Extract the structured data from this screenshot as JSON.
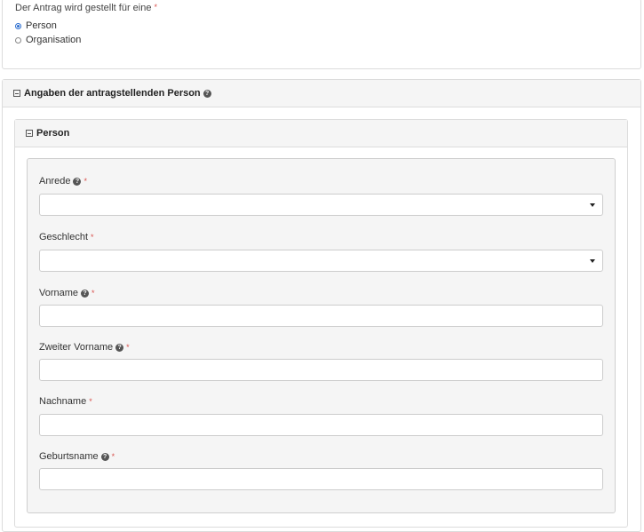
{
  "top": {
    "question": "Der Antrag wird gestellt für eine",
    "required_mark": "*",
    "options": [
      {
        "label": "Person",
        "selected": true
      },
      {
        "label": "Organisation",
        "selected": false
      }
    ]
  },
  "outer_section": {
    "title": "Angaben der antragstellenden Person",
    "help": "?"
  },
  "inner_section": {
    "title": "Person"
  },
  "fields": [
    {
      "label": "Anrede",
      "has_help": true,
      "required": "*",
      "type": "select",
      "value": ""
    },
    {
      "label": "Geschlecht",
      "has_help": false,
      "required": "*",
      "type": "select",
      "value": ""
    },
    {
      "label": "Vorname",
      "has_help": true,
      "required": "*",
      "type": "text",
      "value": ""
    },
    {
      "label": "Zweiter Vorname",
      "has_help": true,
      "required": "*",
      "type": "text",
      "value": ""
    },
    {
      "label": "Nachname",
      "has_help": false,
      "required": "*",
      "type": "text",
      "value": ""
    },
    {
      "label": "Geburtsname",
      "has_help": true,
      "required": "*",
      "type": "text",
      "value": ""
    }
  ],
  "colors": {
    "required": "#d9534f",
    "radio_selected": "#2a6ccf",
    "panel_header": "#f5f5f5"
  }
}
